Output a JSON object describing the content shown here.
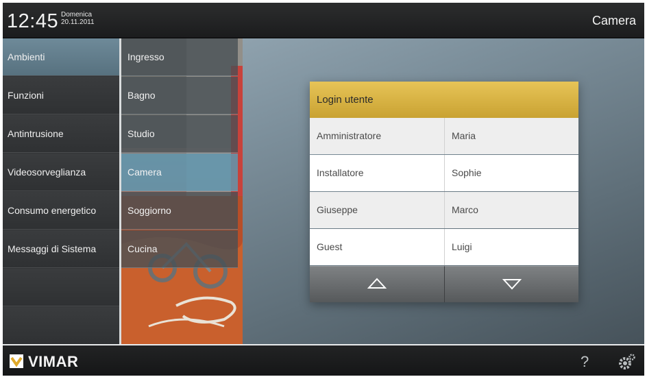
{
  "header": {
    "time": "12:45",
    "weekday": "Domenica",
    "date": "20.11.2011",
    "current_room": "Camera"
  },
  "menu": {
    "items": [
      {
        "label": "Ambienti",
        "active": true
      },
      {
        "label": "Funzioni",
        "active": false
      },
      {
        "label": "Antintrusione",
        "active": false
      },
      {
        "label": "Videosorveglianza",
        "active": false
      },
      {
        "label": "Consumo energetico",
        "active": false
      },
      {
        "label": "Messaggi di Sistema",
        "active": false
      }
    ]
  },
  "rooms": {
    "items": [
      {
        "label": "Ingresso",
        "active": false
      },
      {
        "label": "Bagno",
        "active": false
      },
      {
        "label": "Studio",
        "active": false
      },
      {
        "label": "Camera",
        "active": true
      },
      {
        "label": "Soggiorno",
        "active": false
      },
      {
        "label": "Cucina",
        "active": false
      }
    ]
  },
  "login": {
    "title": "Login utente",
    "users": [
      [
        "Amministratore",
        "Maria"
      ],
      [
        "Installatore",
        "Sophie"
      ],
      [
        "Giuseppe",
        "Marco"
      ],
      [
        "Guest",
        "Luigi"
      ]
    ],
    "scroll_up_icon": "triangle-up-icon",
    "scroll_down_icon": "triangle-down-icon"
  },
  "footer": {
    "brand": "VIMAR",
    "help_label": "?",
    "settings_icon": "gear-icon"
  },
  "colors": {
    "accent_header": "#d4af3f",
    "active_item": "#5f96af",
    "menu_active": "#6e8a99"
  }
}
